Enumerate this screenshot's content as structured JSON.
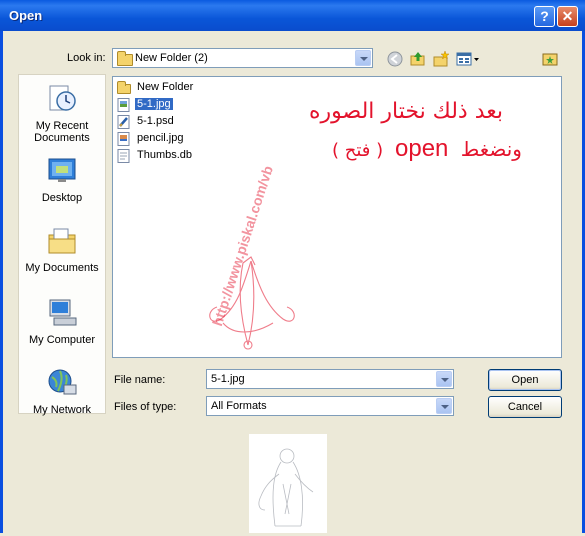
{
  "window": {
    "title": "Open"
  },
  "titlebar": {
    "help": "?",
    "close": "✕"
  },
  "look_in": {
    "label": "Look in:",
    "value": "New Folder (2)"
  },
  "toolbar": {
    "icons": [
      "back-icon",
      "up-folder-icon",
      "new-folder-icon",
      "views-menu-icon",
      "thumbnail-toggle-icon"
    ]
  },
  "places": [
    {
      "label": "My Recent Documents",
      "icon": "recent-documents-icon"
    },
    {
      "label": "Desktop",
      "icon": "desktop-icon"
    },
    {
      "label": "My Documents",
      "icon": "my-documents-icon"
    },
    {
      "label": "My Computer",
      "icon": "my-computer-icon"
    },
    {
      "label": "My Network",
      "icon": "my-network-icon"
    }
  ],
  "files": [
    {
      "name": "New Folder",
      "type": "folder",
      "selected": false
    },
    {
      "name": "5-1.jpg",
      "type": "jpg",
      "selected": true
    },
    {
      "name": "5-1.psd",
      "type": "psd",
      "selected": false
    },
    {
      "name": "pencil.jpg",
      "type": "jpg",
      "selected": false
    },
    {
      "name": "Thumbs.db",
      "type": "db",
      "selected": false
    }
  ],
  "annotation": {
    "line1": "بعد ذلك نختار الصوره",
    "line2_prefix": "ونضغط",
    "line2_english": "open",
    "line3": "( فتح )",
    "watermark": "http://www.piskal.com/vb",
    "color": "#e3132c"
  },
  "file_name": {
    "label": "File name:",
    "value": "5-1.jpg"
  },
  "file_type": {
    "label": "Files of type:",
    "value": "All Formats"
  },
  "buttons": {
    "open": "Open",
    "cancel": "Cancel"
  },
  "colors": {
    "title_bar": "#0a56d8",
    "selection": "#316ac5",
    "dialog_bg": "#ece9d8"
  }
}
